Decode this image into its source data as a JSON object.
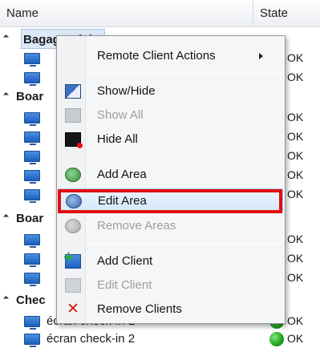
{
  "grid": {
    "columns": {
      "name": "Name",
      "state": "State"
    },
    "rows": [
      {
        "type": "group",
        "label": "Bagage Claim",
        "selected": true
      },
      {
        "type": "client",
        "label": "",
        "state": "OK"
      },
      {
        "type": "client",
        "label": "",
        "state": "OK"
      },
      {
        "type": "group",
        "label": "Boar"
      },
      {
        "type": "client",
        "label": "",
        "state": "OK"
      },
      {
        "type": "client",
        "label": "",
        "state": "OK"
      },
      {
        "type": "client",
        "label": "",
        "state": "OK"
      },
      {
        "type": "client",
        "label": "",
        "state": "OK"
      },
      {
        "type": "client",
        "label": "",
        "state": "OK"
      },
      {
        "type": "group",
        "label": "Boar"
      },
      {
        "type": "client",
        "label": "",
        "state": "OK"
      },
      {
        "type": "client",
        "label": "",
        "state": "OK"
      },
      {
        "type": "client",
        "label": "",
        "state": "OK"
      },
      {
        "type": "group",
        "label": "Chec"
      },
      {
        "type": "client",
        "label": "écran check-in 1",
        "state": "OK"
      },
      {
        "type": "client",
        "label": "écran check-in 2",
        "state": "OK"
      }
    ]
  },
  "menu": {
    "items": [
      {
        "label": "Remote Client Actions",
        "icon": "none",
        "submenu": true,
        "disabled": false
      },
      {
        "label": "Show/Hide",
        "icon": "show-hide-icon",
        "disabled": false
      },
      {
        "label": "Show All",
        "icon": "show-all-icon",
        "disabled": true
      },
      {
        "label": "Hide All",
        "icon": "hide-all-icon",
        "disabled": false
      },
      {
        "label": "Add Area",
        "icon": "add-area-icon",
        "disabled": false
      },
      {
        "label": "Edit Area",
        "icon": "edit-area-icon",
        "disabled": false,
        "highlighted": true
      },
      {
        "label": "Remove Areas",
        "icon": "remove-areas-icon",
        "disabled": true
      },
      {
        "label": "Add Client",
        "icon": "add-client-icon",
        "disabled": false
      },
      {
        "label": "Edit Client",
        "icon": "edit-client-icon",
        "disabled": true
      },
      {
        "label": "Remove Clients",
        "icon": "remove-clients-icon",
        "disabled": false
      }
    ]
  },
  "colors": {
    "highlight_box": "#e10e0e",
    "status_ok": "#1aa11a",
    "selection": "#dbe9f8"
  }
}
